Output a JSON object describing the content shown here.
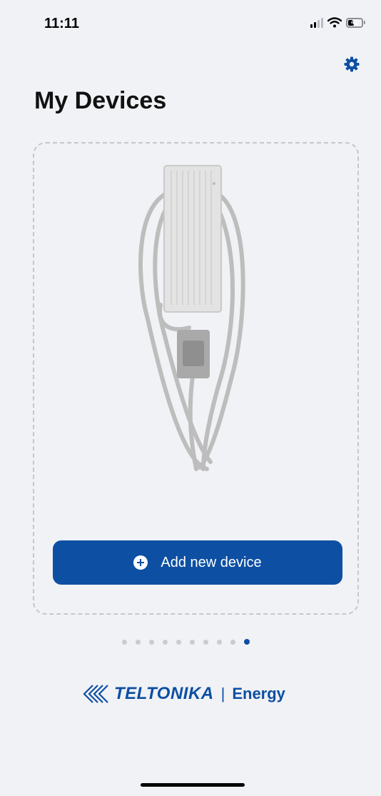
{
  "status_bar": {
    "time": "11:11",
    "battery_level": "41",
    "icons": [
      "signal-icon",
      "wifi-icon",
      "battery-icon"
    ]
  },
  "header": {
    "title": "My Devices",
    "settings_icon": "gear-icon"
  },
  "device_card": {
    "image": "ev-charger-placeholder",
    "add_button_label": "Add new device",
    "add_button_icon": "plus-circle-icon"
  },
  "pagination": {
    "total": 10,
    "active_index": 9
  },
  "branding": {
    "logo_name": "TELTONIKA",
    "separator": "|",
    "subtitle": "Energy"
  },
  "colors": {
    "background": "#f0f2f5",
    "accent": "#0d4fa3",
    "text": "#111111",
    "placeholder": "#c4c7cc"
  }
}
